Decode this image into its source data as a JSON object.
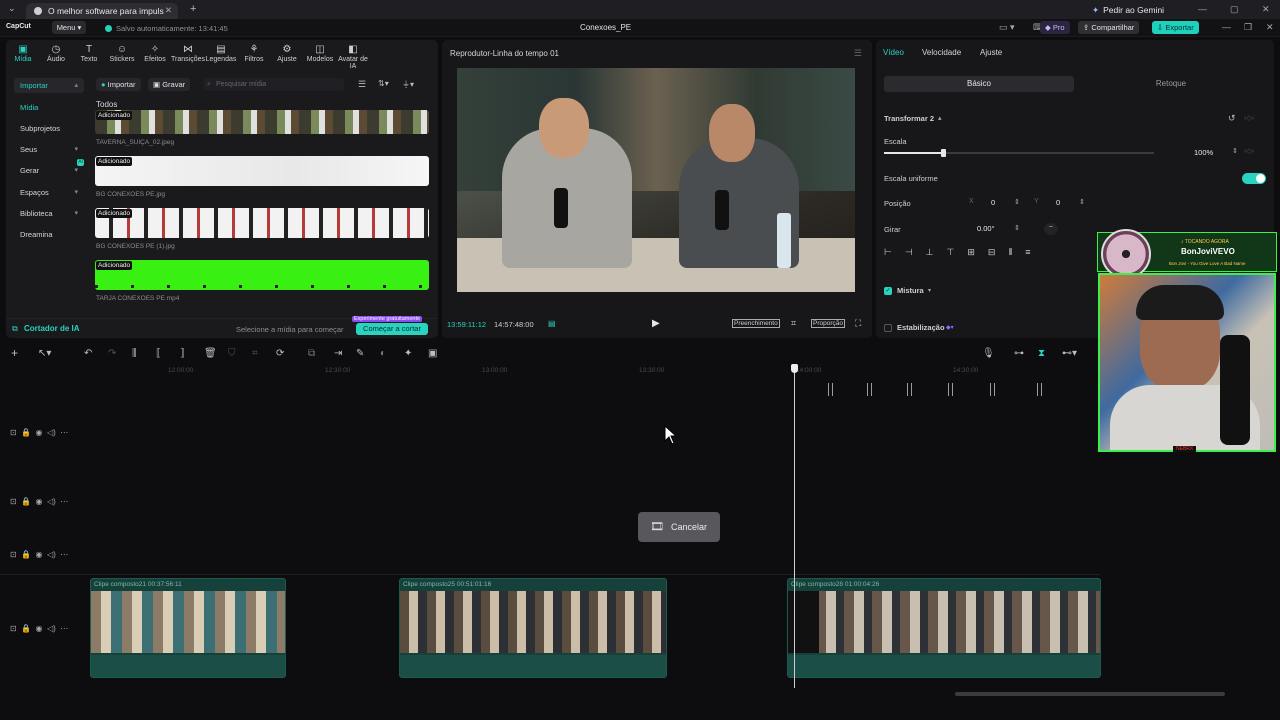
{
  "browser": {
    "tab_title": "O melhor software para impuls",
    "gemini_label": "Pedir ao Gemini"
  },
  "app": {
    "logo": "CapCut",
    "menu_label": "Menu",
    "saved_status": "Salvo automaticamente: 13:41:45",
    "project_title": "Conexoes_PE",
    "pro_label": "Pro",
    "share_label": "Compartilhar",
    "export_label": "Exportar"
  },
  "toolbar": {
    "items": [
      {
        "label": "Mídia",
        "icon": "media-icon"
      },
      {
        "label": "Áudio",
        "icon": "audio-icon"
      },
      {
        "label": "Texto",
        "icon": "text-icon"
      },
      {
        "label": "Stickers",
        "icon": "sticker-icon"
      },
      {
        "label": "Efeitos",
        "icon": "effects-icon"
      },
      {
        "label": "Transições",
        "icon": "transitions-icon"
      },
      {
        "label": "Legendas",
        "icon": "captions-icon"
      },
      {
        "label": "Filtros",
        "icon": "filters-icon"
      },
      {
        "label": "Ajuste",
        "icon": "adjust-icon"
      },
      {
        "label": "Modelos",
        "icon": "templates-icon"
      },
      {
        "label": "Avatar de IA",
        "icon": "ai-avatar-icon"
      }
    ]
  },
  "leftnav": {
    "items": [
      {
        "label": "Importar",
        "chevron": "▴"
      },
      {
        "label": "Mídia",
        "chevron": ""
      },
      {
        "label": "Subprojetos",
        "chevron": ""
      },
      {
        "label": "Seus",
        "chevron": "▾"
      },
      {
        "label": "Gerar",
        "chevron": "▾",
        "badge": "AI"
      },
      {
        "label": "Espaços",
        "chevron": "▾"
      },
      {
        "label": "Biblioteca",
        "chevron": "▾"
      },
      {
        "label": "Dreamina",
        "chevron": ""
      }
    ]
  },
  "media": {
    "import_label": "Importar",
    "record_label": "Gravar",
    "search_placeholder": "Pesquisar mídia",
    "section_label": "Todos",
    "items": [
      {
        "badge": "Adicionado",
        "caption": "TAVERNA_SUIÇA_02.jpeg"
      },
      {
        "badge": "Adicionado",
        "caption": "BG CONEXOES PE.jpg"
      },
      {
        "badge": "Adicionado",
        "caption": "BG CONEXOES PE (1).jpg"
      },
      {
        "badge": "Adicionado",
        "caption": "TARJA CONEXOES PE.mp4"
      }
    ],
    "cutter_label": "Cortador de IA",
    "cutter_hint": "Selecione a mídia para começar",
    "cutter_free_badge": "Experimente gratuitamente",
    "cutter_button": "Começar a cortar"
  },
  "player": {
    "title": "Reprodutor-Linha do tempo 01",
    "current_time": "13:59:11:12",
    "total_time": "14:57:48:00",
    "fill_label": "Preenchimento",
    "ratio_label": "Proporção"
  },
  "props": {
    "tabs": [
      "Vídeo",
      "Velocidade",
      "Ajuste"
    ],
    "subtabs": [
      "Básico",
      "Retoque"
    ],
    "transform_label": "Transformar 2",
    "scale_label": "Escala",
    "scale_value": "100%",
    "scale_level": 0.5,
    "uniform_label": "Escala uniforme",
    "position_label": "Posição",
    "pos_x_label": "X",
    "pos_x": "0",
    "pos_y_label": "Y",
    "pos_y": "0",
    "rotate_label": "Girar",
    "rotate_value": "0.00°",
    "blend_label": "Mistura",
    "stabilize_label": "Estabilização"
  },
  "overlay": {
    "now_playing": "♪ TOCANDO AGORA",
    "artist": "BonJoviVEVO",
    "song": "Bon Jovi - You Give Love A Bad Name",
    "tag": "NEBRX"
  },
  "timeline": {
    "ruler": [
      "12:00:00",
      "12:30:00",
      "13:00:00",
      "13:30:00",
      "14:00:00",
      "14:30:00"
    ],
    "cancel_label": "Cancelar",
    "clips": [
      {
        "label": "Clipe composto21",
        "duration": "00:37:56:11"
      },
      {
        "label": "Clipe composto25",
        "duration": "00:51:01:16"
      },
      {
        "label": "Clipe composto28",
        "duration": "01:00:04:26"
      }
    ]
  },
  "colors": {
    "accent": "#29d3c0",
    "export": "#1fd1bd",
    "clip": "#16403a"
  }
}
